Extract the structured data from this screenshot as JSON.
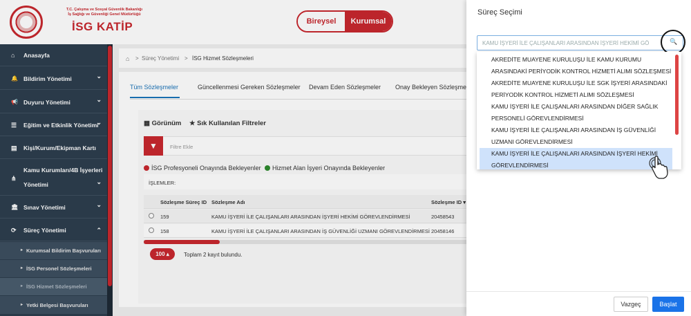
{
  "header": {
    "org_line1": "T.C. Çalışma ve Sosyal Güvenlik Bakanlığı",
    "org_line2": "İş Sağlığı ve Güvenliği Genel Müdürlüğü",
    "app_title": "İSG KATİP",
    "toggle_left": "Bireysel",
    "toggle_right": "Kurumsal"
  },
  "sidebar": {
    "items": [
      {
        "label": "Anasayfa",
        "icon": "home-icon",
        "icon_glyph": "⌂"
      },
      {
        "label": "Bildirim Yönetimi",
        "icon": "bell-icon",
        "icon_glyph": "🔔"
      },
      {
        "label": "Duyuru Yönetimi",
        "icon": "megaphone-icon",
        "icon_glyph": "📢"
      },
      {
        "label": "Eğitim ve Etkinlik Yönetimi",
        "icon": "list-icon",
        "icon_glyph": "☰"
      },
      {
        "label": "Kişi/Kurum/Ekipman Kartı",
        "icon": "card-icon",
        "icon_glyph": "▤"
      },
      {
        "label_line1": "Kamu Kurumları/4B İşyerleri",
        "label_line2": "Yönetimi",
        "icon": "sitemap-icon",
        "icon_glyph": "⋔"
      },
      {
        "label": "Sınav Yönetimi",
        "icon": "bank-icon",
        "icon_glyph": "🏛"
      },
      {
        "label": "Süreç Yönetimi",
        "icon": "refresh-icon",
        "icon_glyph": "⟳"
      }
    ],
    "chevron_down": "⌄",
    "chevron_up": "⌃",
    "sub_items": [
      {
        "label": "Kurumsal Bildirim Başvuruları"
      },
      {
        "label": "İSG Personel Sözleşmeleri"
      },
      {
        "label": "İSG Hizmet Sözleşmeleri"
      },
      {
        "label": "Yetki Belgesi Başvuruları"
      }
    ]
  },
  "breadcrumb": {
    "home_icon": "⌂",
    "separator": ">",
    "level1": "Süreç Yönetimi",
    "level2": "İSG Hizmet Sözleşmeleri"
  },
  "tabs": [
    {
      "label": "Tüm Sözleşmeler"
    },
    {
      "label": "Güncellenmesi Gereken Sözleşmeler"
    },
    {
      "label": "Devam Eden Sözleşmeler"
    },
    {
      "label": "Onay Bekleyen Sözleşmeler"
    }
  ],
  "toolbar": {
    "view_label": "Görünüm",
    "view_icon": "▦",
    "filters_label": "Sık Kullanılan Filtreler",
    "filters_icon": "★",
    "filter_icon": "▼",
    "filter_placeholder": "Filtre Ekle"
  },
  "legend": {
    "red_label": "İSG Profesyoneli Onayında Bekleyenler",
    "green_label": "Hizmet Alan İşyeri Onayında Bekleyenler"
  },
  "islemler": "İŞLEMLER:",
  "table": {
    "columns": [
      "Sözleşme Süreç ID",
      "Sözleşme Adı",
      "Sözleşme ID ▾"
    ],
    "rows": [
      {
        "process_id": "159",
        "name": "KAMU İŞYERİ İLE ÇALIŞANLARI ARASINDAN İŞYERİ HEKİMİ GÖREVLENDİRMESİ",
        "contract_id": "20458543"
      },
      {
        "process_id": "158",
        "name": "KAMU İŞYERİ İLE ÇALIŞANLARI ARASINDAN İŞ GÜVENLİĞİ UZMANI GÖREVLENDİRMESİ",
        "contract_id": "20458146"
      }
    ]
  },
  "pager": {
    "page_size": "100 ▴",
    "total_text": "Toplam 2 kayıt bulundu."
  },
  "panel": {
    "title": "Süreç Seçimi",
    "select_value": "KAMU İŞYERİ İLE ÇALIŞANLARI ARASINDAN İŞYERİ HEKİMİ GÖ",
    "search_icon": "🔍",
    "options": [
      {
        "line1": "AKREDİTE MUAYENE KURULUŞU İLE KAMU KURUMU",
        "line2": "ARASINDAKİ PERİYODİK KONTROL HİZMETİ ALIMI SÖZLEŞMESİ"
      },
      {
        "line1": "AKREDİTE MUAYENE KURULUŞU İLE SGK İŞYERİ ARASINDAKİ",
        "line2": "PERİYODİK KONTROL HİZMETİ ALIMI SÖZLEŞMESİ"
      },
      {
        "line1": "KAMU İŞYERİ İLE ÇALIŞANLARI ARASINDAN DİĞER SAĞLIK",
        "line2": "PERSONELİ GÖREVLENDİRMESİ"
      },
      {
        "line1": "KAMU İŞYERİ İLE ÇALIŞANLARI ARASINDAN İŞ GÜVENLİĞİ",
        "line2": "UZMANI GÖREVLENDİRMESİ"
      },
      {
        "line1": "KAMU İŞYERİ İLE ÇALIŞANLARI ARASINDAN İŞYERİ HEKİMİ",
        "line2": "GÖREVLENDİRMESİ",
        "selected": true
      }
    ],
    "cancel_label": "Vazgeç",
    "start_label": "Başlat"
  },
  "colors": {
    "brand_red": "#c8282e",
    "sidebar_bg": "#2d3e4e",
    "accent_blue": "#1a73e8",
    "status_red": "#c8282e",
    "status_green": "#2e8b2e"
  }
}
